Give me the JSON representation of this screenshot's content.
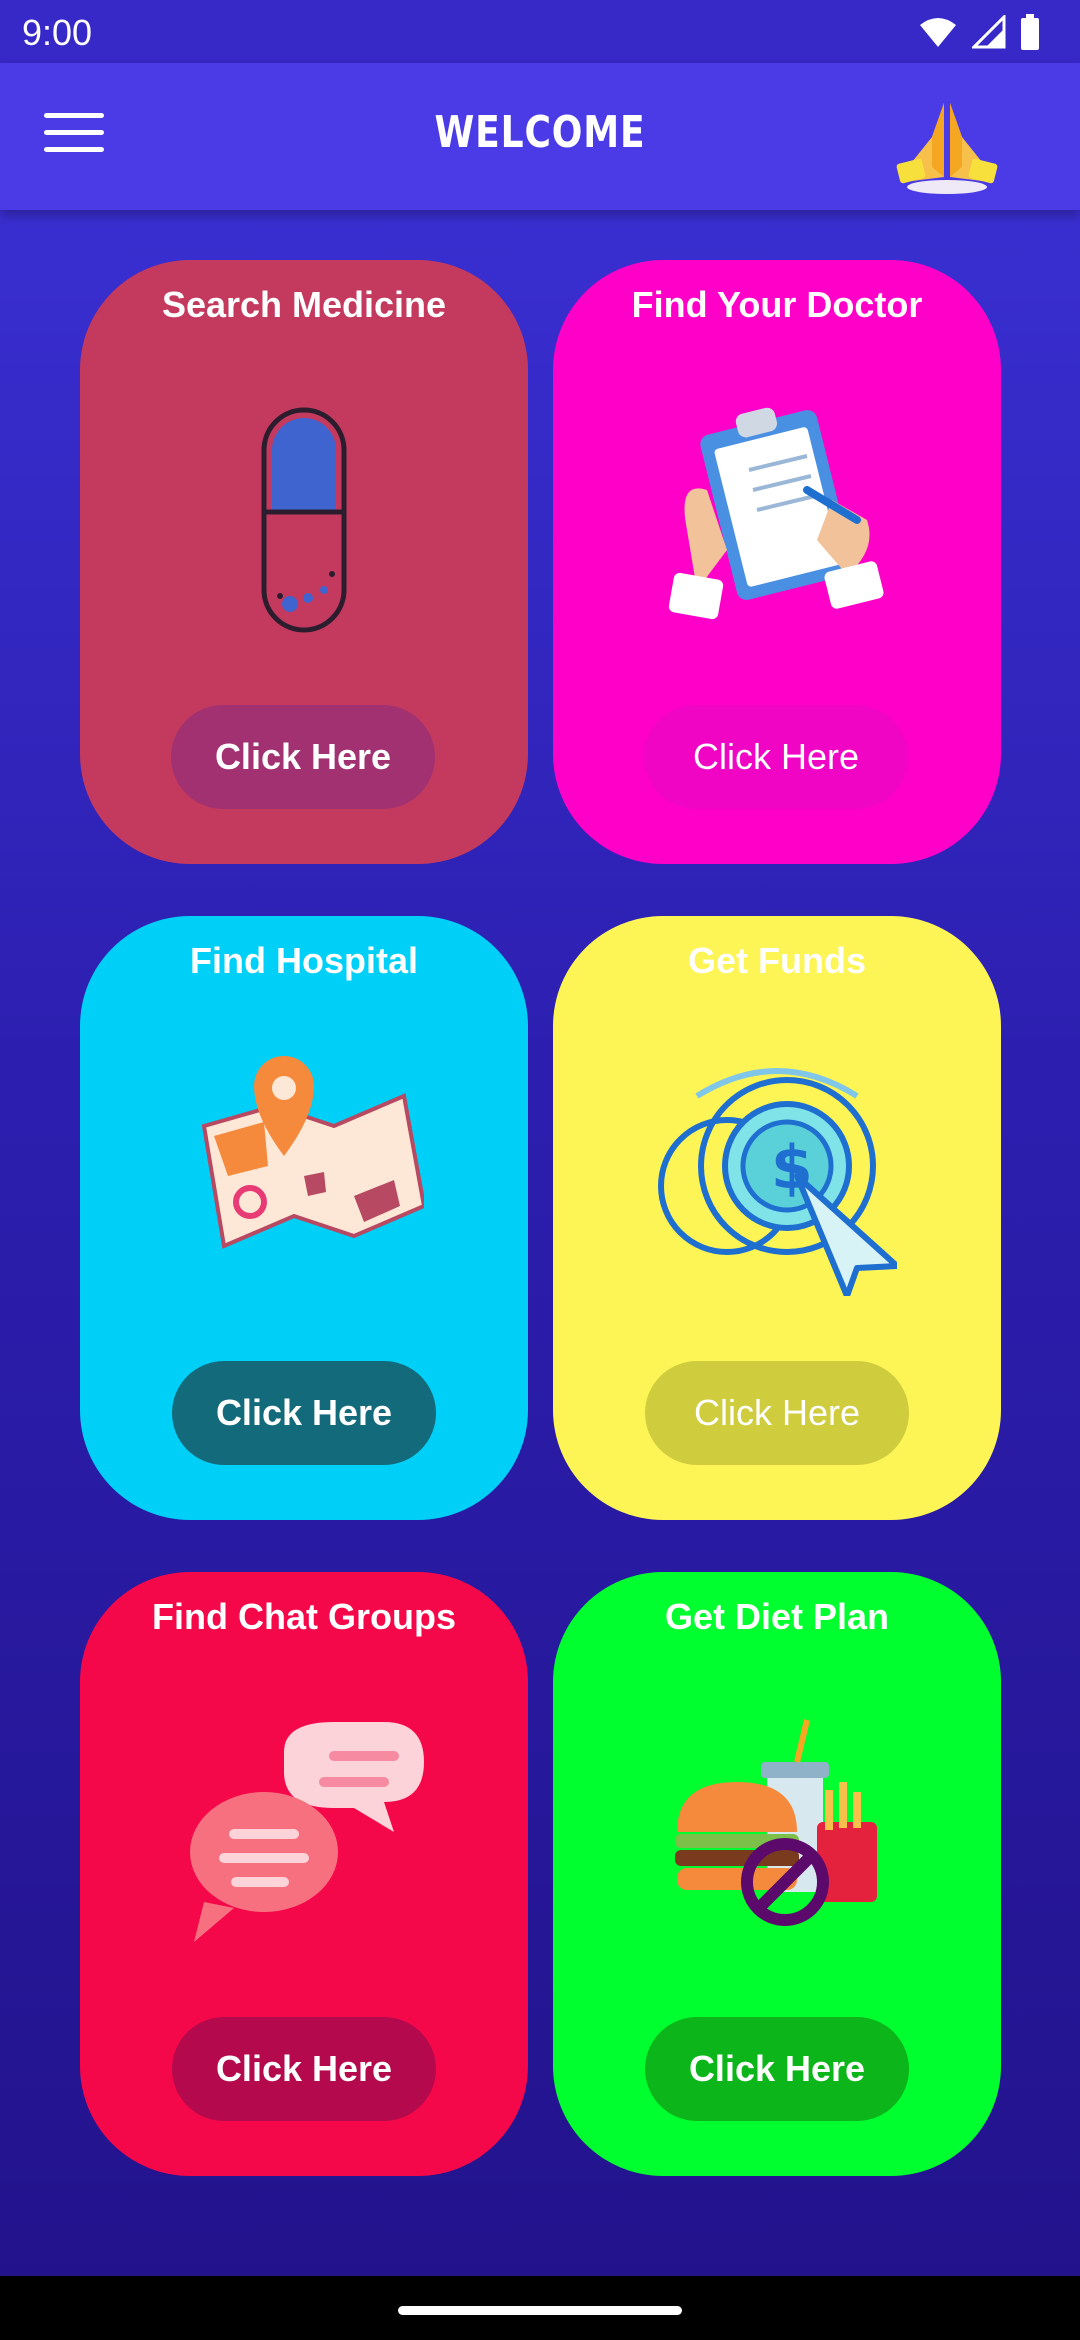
{
  "status": {
    "time": "9:00"
  },
  "app_bar": {
    "title": "WELCOME"
  },
  "cards": [
    {
      "title": "Search Medicine",
      "button": "Click Here",
      "icon": "capsule-icon",
      "bg": "#c43a5e",
      "btn_bg": "#a23172",
      "btn_fg": "#ffffff"
    },
    {
      "title": "Find Your Doctor",
      "button": "Click Here",
      "icon": "clipboard-prescription-icon",
      "bg": "#ff00c8",
      "btn_bg": "#f005c4",
      "btn_fg": "#ffffff"
    },
    {
      "title": "Find Hospital",
      "button": "Click Here",
      "icon": "map-location-icon",
      "bg": "#00cff8",
      "btn_bg": "#136a7a",
      "btn_fg": "#ffffff"
    },
    {
      "title": "Get Funds",
      "button": "Click Here",
      "icon": "dollar-coin-click-icon",
      "bg": "#fdf555",
      "btn_bg": "#cfcc3e",
      "btn_fg": "#ffffff"
    },
    {
      "title": "Find Chat Groups",
      "button": "Click Here",
      "icon": "chat-bubbles-icon",
      "bg": "#f5084a",
      "btn_bg": "#b5094e",
      "btn_fg": "#ffffff"
    },
    {
      "title": "Get Diet Plan",
      "button": "Click Here",
      "icon": "no-junk-food-icon",
      "bg": "#00ff2e",
      "btn_bg": "#0bb51a",
      "btn_fg": "#ffffff"
    }
  ]
}
